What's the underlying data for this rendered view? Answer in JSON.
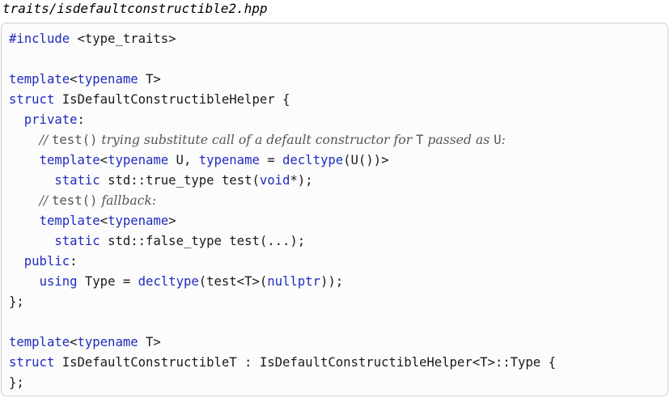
{
  "filename": "traits/isdefaultconstructible2.hpp",
  "colors": {
    "keyword": "#1f2bbf",
    "text": "#1a1a1a",
    "comment": "#555555",
    "box_border": "#cfcfcf",
    "box_background": "#fcfcfc"
  },
  "code_lines": [
    [
      {
        "t": "#include",
        "k": "kw"
      },
      {
        "t": " <type_traits>"
      }
    ],
    [],
    [
      {
        "t": "template",
        "k": "kw"
      },
      {
        "t": "<"
      },
      {
        "t": "typename",
        "k": "kw"
      },
      {
        "t": " T>"
      }
    ],
    [
      {
        "t": "struct",
        "k": "kw"
      },
      {
        "t": " IsDefaultConstructibleHelper {"
      }
    ],
    [
      {
        "t": "  "
      },
      {
        "t": "private",
        "k": "kw"
      },
      {
        "t": ":"
      }
    ],
    [
      {
        "t": "    "
      },
      {
        "t": "// ",
        "k": "cm"
      },
      {
        "t": "test()",
        "k": "cc"
      },
      {
        "t": " trying substitute call of a default constructor for ",
        "k": "cm"
      },
      {
        "t": "T",
        "k": "cc"
      },
      {
        "t": " passed as ",
        "k": "cm"
      },
      {
        "t": "U",
        "k": "cc"
      },
      {
        "t": ":",
        "k": "cm"
      }
    ],
    [
      {
        "t": "    "
      },
      {
        "t": "template",
        "k": "kw"
      },
      {
        "t": "<"
      },
      {
        "t": "typename",
        "k": "kw"
      },
      {
        "t": " U, "
      },
      {
        "t": "typename",
        "k": "kw"
      },
      {
        "t": " = "
      },
      {
        "t": "decltype",
        "k": "kw"
      },
      {
        "t": "(U())>"
      }
    ],
    [
      {
        "t": "      "
      },
      {
        "t": "static",
        "k": "kw"
      },
      {
        "t": " std::true_type test("
      },
      {
        "t": "void",
        "k": "kw"
      },
      {
        "t": "*);"
      }
    ],
    [
      {
        "t": "    "
      },
      {
        "t": "// ",
        "k": "cm"
      },
      {
        "t": "test()",
        "k": "cc"
      },
      {
        "t": " fallback:",
        "k": "cm"
      }
    ],
    [
      {
        "t": "    "
      },
      {
        "t": "template",
        "k": "kw"
      },
      {
        "t": "<"
      },
      {
        "t": "typename",
        "k": "kw"
      },
      {
        "t": ">"
      }
    ],
    [
      {
        "t": "      "
      },
      {
        "t": "static",
        "k": "kw"
      },
      {
        "t": " std::false_type test(...);"
      }
    ],
    [
      {
        "t": "  "
      },
      {
        "t": "public",
        "k": "kw"
      },
      {
        "t": ":"
      }
    ],
    [
      {
        "t": "    "
      },
      {
        "t": "using",
        "k": "kw"
      },
      {
        "t": " Type = "
      },
      {
        "t": "decltype",
        "k": "kw"
      },
      {
        "t": "(test<T>("
      },
      {
        "t": "nullptr",
        "k": "kw"
      },
      {
        "t": "));"
      }
    ],
    [
      {
        "t": "};"
      }
    ],
    [],
    [
      {
        "t": "template",
        "k": "kw"
      },
      {
        "t": "<"
      },
      {
        "t": "typename",
        "k": "kw"
      },
      {
        "t": " T>"
      }
    ],
    [
      {
        "t": "struct",
        "k": "kw"
      },
      {
        "t": " IsDefaultConstructibleT : IsDefaultConstructibleHelper<T>::Type {"
      }
    ],
    [
      {
        "t": "};"
      }
    ]
  ]
}
